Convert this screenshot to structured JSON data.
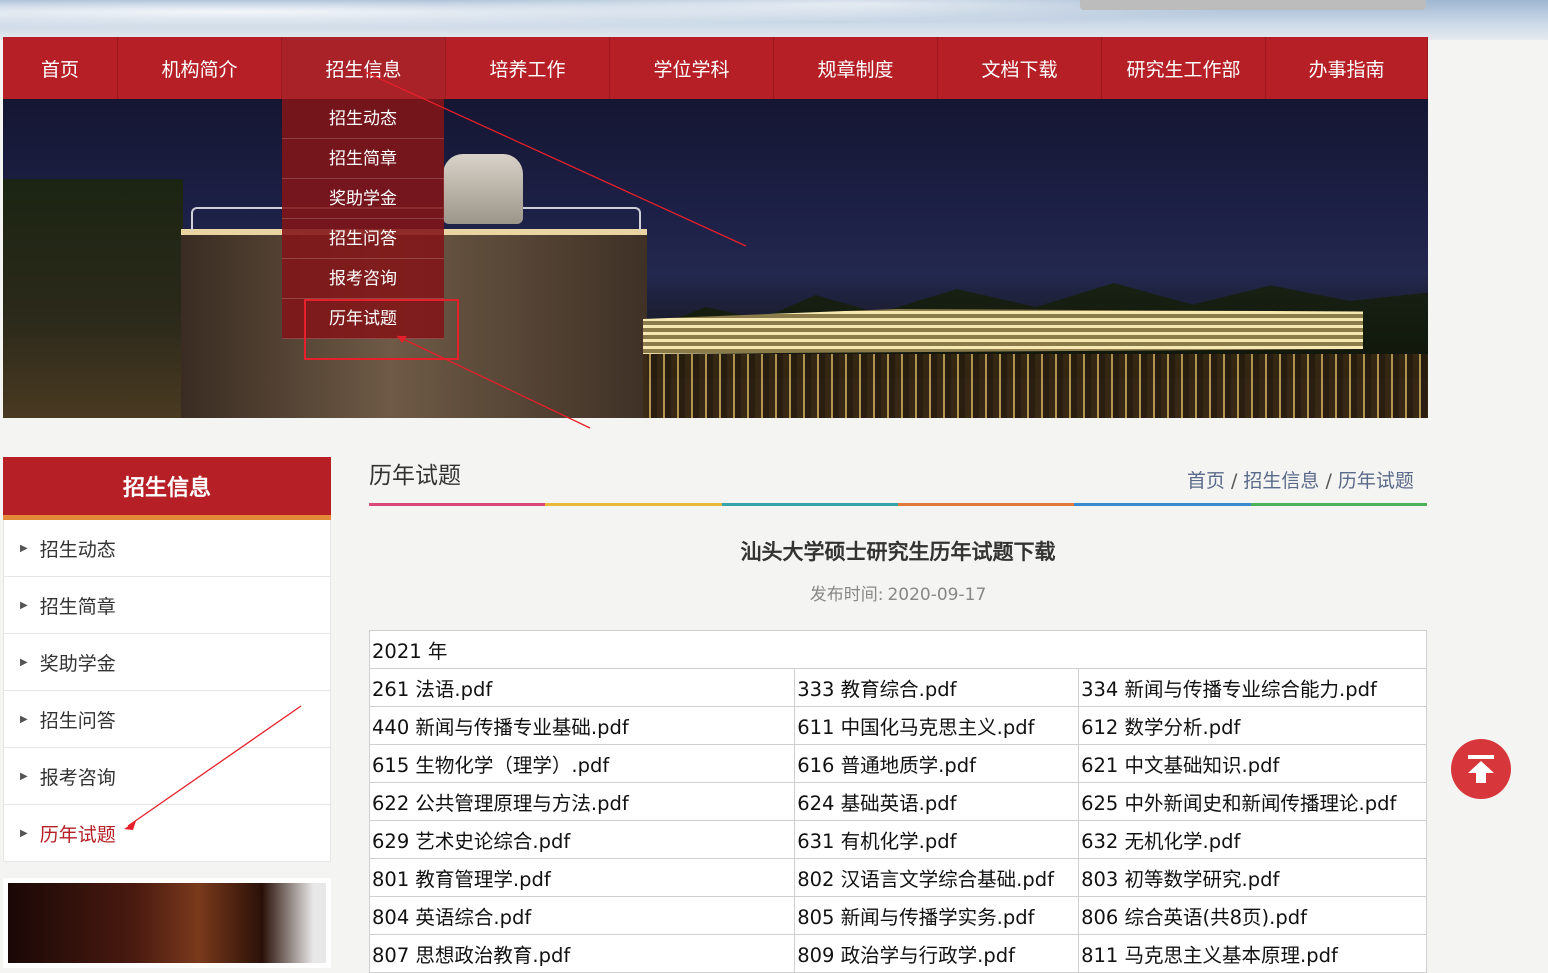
{
  "nav": {
    "items": [
      {
        "label": "首页",
        "width": 115
      },
      {
        "label": "机构简介",
        "width": 164
      },
      {
        "label": "招生信息",
        "width": 164
      },
      {
        "label": "培养工作",
        "width": 164
      },
      {
        "label": "学位学科",
        "width": 164
      },
      {
        "label": "规章制度",
        "width": 164
      },
      {
        "label": "文档下载",
        "width": 164
      },
      {
        "label": "研究生工作部",
        "width": 164
      },
      {
        "label": "办事指南",
        "width": 162
      }
    ],
    "active_index": 2,
    "dropdown": [
      "招生动态",
      "招生简章",
      "奖助学金",
      "招生问答",
      "报考咨询",
      "历年试题"
    ]
  },
  "sidebar": {
    "title": "招生信息",
    "items": [
      "招生动态",
      "招生简章",
      "奖助学金",
      "招生问答",
      "报考咨询",
      "历年试题"
    ],
    "active_index": 5
  },
  "main": {
    "title": "历年试题",
    "breadcrumb": [
      "首页",
      "招生信息",
      "历年试题"
    ],
    "colorbar": [
      "#d9487a",
      "#e8b93a",
      "#36a3a8",
      "#e07a3a",
      "#3a8ad0",
      "#4ab35a"
    ],
    "article_title": "汕头大学硕士研究生历年试题下载",
    "pubdate_label": "发布时间:",
    "pubdate": "2020-09-17",
    "year_header": "2021 年",
    "files": [
      [
        "261 法语.pdf",
        "333 教育综合.pdf",
        "334 新闻与传播专业综合能力.pdf"
      ],
      [
        "440 新闻与传播专业基础.pdf",
        "611 中国化马克思主义.pdf",
        "612 数学分析.pdf"
      ],
      [
        "615 生物化学（理学）.pdf",
        "616 普通地质学.pdf",
        "621 中文基础知识.pdf"
      ],
      [
        "622 公共管理原理与方法.pdf",
        "624 基础英语.pdf",
        "625 中外新闻史和新闻传播理论.pdf"
      ],
      [
        "629 艺术史论综合.pdf",
        "631 有机化学.pdf",
        "632 无机化学.pdf"
      ],
      [
        "801 教育管理学.pdf",
        "802 汉语言文学综合基础.pdf",
        "803 初等数学研究.pdf"
      ],
      [
        "804 英语综合.pdf",
        "805 新闻与传播学实务.pdf",
        "806 综合英语(共8页).pdf"
      ],
      [
        "807 思想政治教育.pdf",
        "809 政治学与行政学.pdf",
        "811 马克思主义基本原理.pdf"
      ]
    ]
  },
  "icons": {
    "back_to_top": "arrow-up-to-top-icon"
  },
  "colors": {
    "brand_red": "#b51f25",
    "accent_orange": "#e28a3a",
    "annotation_red": "#e5202a"
  }
}
